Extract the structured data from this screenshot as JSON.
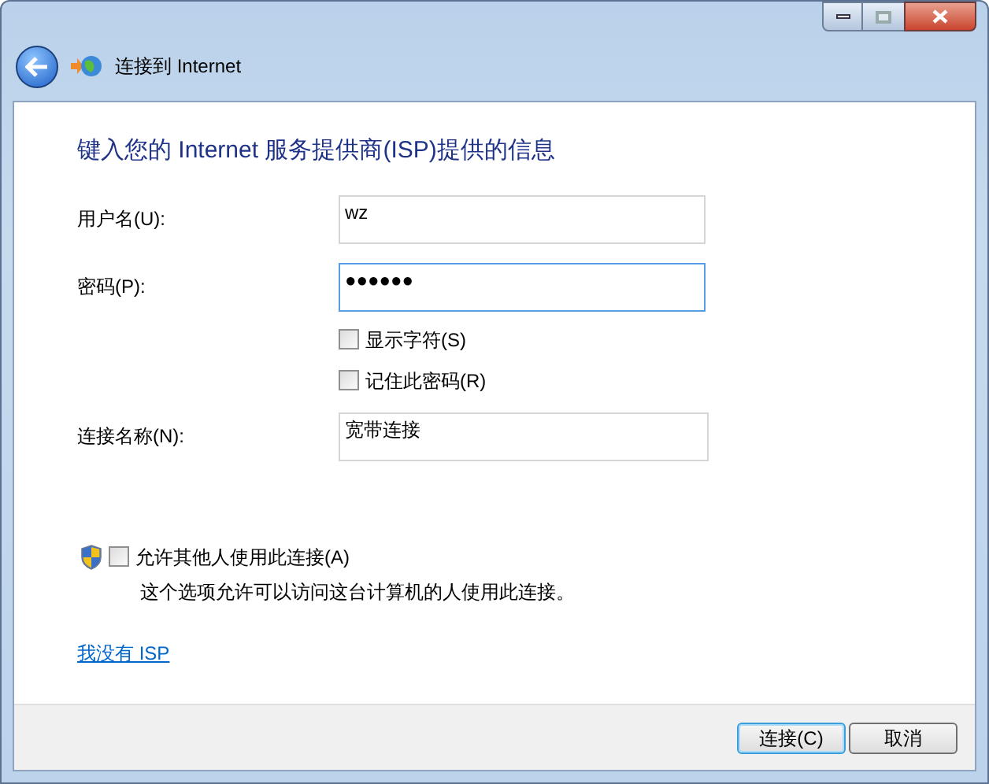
{
  "window": {
    "title": "连接到 Internet"
  },
  "heading": "键入您的 Internet 服务提供商(ISP)提供的信息",
  "fields": [
    {
      "label": "用户名(U):",
      "value": "wz",
      "focused": false
    },
    {
      "label": "密码(P):",
      "value": "●●●●●●",
      "focused": true
    }
  ],
  "options": [
    {
      "label": "显示字符(S)",
      "checked": false
    },
    {
      "label": "记住此密码(R)",
      "checked": false
    }
  ],
  "connection_name": {
    "label": "连接名称(N):",
    "value": "宽带连接",
    "focused": false
  },
  "share": {
    "label": "允许其他人使用此连接(A)",
    "checked": false,
    "description": "这个选项允许可以访问这台计算机的人使用此连接。"
  },
  "link": "我没有 ISP",
  "buttons": [
    {
      "label": "连接(C)",
      "default": true
    },
    {
      "label": "取消",
      "default": false
    }
  ]
}
